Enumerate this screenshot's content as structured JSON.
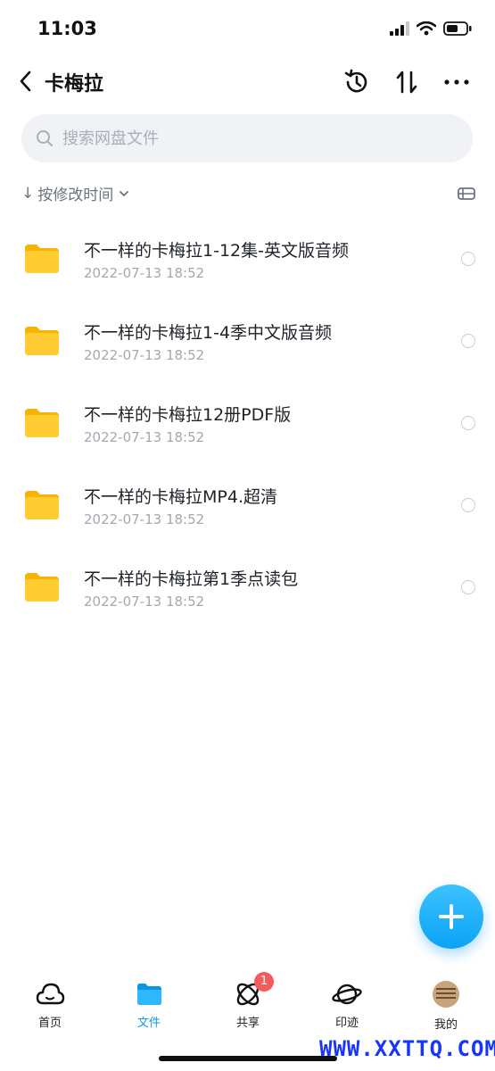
{
  "status_bar": {
    "time": "11:03"
  },
  "header": {
    "title": "卡梅拉"
  },
  "search": {
    "placeholder": "搜索网盘文件"
  },
  "sort": {
    "label": "按修改时间"
  },
  "files": [
    {
      "name": "不一样的卡梅拉1-12集-英文版音频",
      "date": "2022-07-13 18:52",
      "icon": "folder-icon"
    },
    {
      "name": "不一样的卡梅拉1-4季中文版音频",
      "date": "2022-07-13 18:52",
      "icon": "folder-icon"
    },
    {
      "name": "不一样的卡梅拉12册PDF版",
      "date": "2022-07-13 18:52",
      "icon": "folder-icon"
    },
    {
      "name": "不一样的卡梅拉MP4.超清",
      "date": "2022-07-13 18:52",
      "icon": "folder-icon"
    },
    {
      "name": "不一样的卡梅拉第1季点读包",
      "date": "2022-07-13 18:52",
      "icon": "folder-icon"
    }
  ],
  "nav": {
    "items": [
      {
        "label": "首页",
        "icon": "cloud-icon"
      },
      {
        "label": "文件",
        "icon": "folder-icon"
      },
      {
        "label": "共享",
        "icon": "atom-icon",
        "badge": "1"
      },
      {
        "label": "印迹",
        "icon": "planet-icon"
      },
      {
        "label": "我的",
        "icon": "avatar"
      }
    ],
    "active": "文件"
  },
  "watermark": "WWW.XXTTQ.COM",
  "colors": {
    "accent": "#1296ef",
    "folder": "#ffcc33",
    "badge": "#f45b5b",
    "watermark": "#1636ff"
  }
}
